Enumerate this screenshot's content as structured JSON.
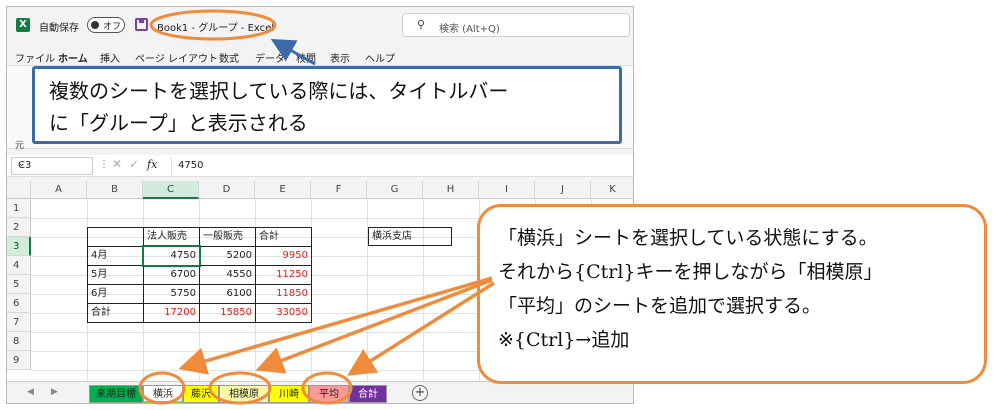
{
  "titlebar": {
    "app_icon": "excel-logo-icon",
    "app_letter": "X",
    "autosave_label": "自動保存",
    "autosave_toggle": "オフ",
    "save_icon": "save-icon",
    "doc_title": "Book1 - グループ - Excel",
    "search_placeholder": "検索 (Alt+Q)",
    "search_icon": "search-icon"
  },
  "menu": [
    "ファイル",
    "ホーム",
    "挿入",
    "ページ レイアウト",
    "数式",
    "データ",
    "校閲",
    "表示",
    "ヘルプ"
  ],
  "ribbon": {
    "footer_label": "元"
  },
  "formula_bar": {
    "name_box": "C3",
    "name_box_icon": "chevron-down-icon",
    "cancel_icon": "close-icon",
    "enter_icon": "check-icon",
    "fx": "fx",
    "value": "4750"
  },
  "columns": [
    "A",
    "B",
    "C",
    "D",
    "E",
    "F",
    "G",
    "H",
    "I",
    "J",
    "K"
  ],
  "rows": [
    "1",
    "2",
    "3",
    "4",
    "5",
    "6",
    "7",
    "8",
    "9"
  ],
  "table": {
    "headers": [
      "法人販売",
      "一般販売",
      "合計"
    ],
    "row_labels": [
      "4月",
      "5月",
      "6月",
      "合計"
    ],
    "corporate": [
      "4750",
      "6700",
      "5750",
      "17200"
    ],
    "general": [
      "5200",
      "4550",
      "6100",
      "15850"
    ],
    "total": [
      "9950",
      "11250",
      "11850",
      "33050"
    ],
    "branch_label": "横浜支店"
  },
  "sheet_tabs": [
    "来期目標",
    "横浜",
    "藤沢",
    "相模原",
    "川崎",
    "平均",
    "合計"
  ],
  "sheet_nav": {
    "prev": "◀",
    "next": "▶",
    "add": "+"
  },
  "colors": {
    "excel_green": "#107c41",
    "red_values": "#e02020",
    "callout_blue": "#3d6aa8",
    "callout_orange": "#ef8c3c",
    "tab_green": "#00b050",
    "tab_yellow": "#ffff00",
    "tab_pink": "#ff9999",
    "tab_purple": "#7030a0"
  },
  "callouts": {
    "blue": [
      "複数のシートを選択している際には、タイトルバー",
      "に「グループ」と表示される"
    ],
    "orange": [
      "「横浜」シートを選択している状態にする。",
      "それから{Ctrl}キーを押しながら「相模原」",
      "「平均」のシートを追加で選択する。",
      "※{Ctrl}→追加"
    ]
  }
}
